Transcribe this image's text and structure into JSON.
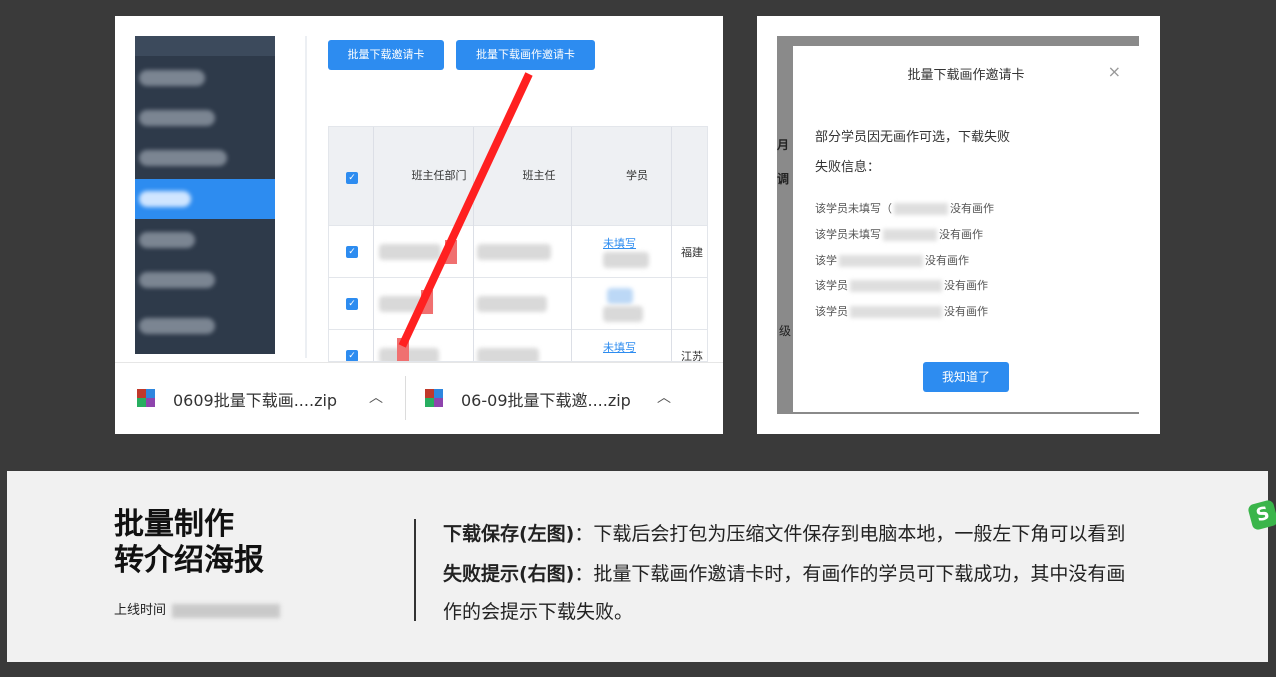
{
  "left_screenshot": {
    "buttons": {
      "batch_download_invitation": "批量下载邀请卡",
      "batch_download_artwork_invitation": "批量下载画作邀请卡"
    },
    "table": {
      "headers": [
        "班主任部门",
        "班主任",
        "学员"
      ],
      "rows": [
        {
          "checked": true,
          "student_link": "未填写",
          "tail": "福建"
        },
        {
          "checked": true,
          "student_link": "",
          "tail": ""
        },
        {
          "checked": true,
          "student_link": "未填写",
          "tail": "江苏"
        }
      ]
    },
    "downloads": [
      {
        "name": "0609批量下载画....zip"
      },
      {
        "name": "06-09批量下载邀....zip"
      }
    ],
    "colors": {
      "accent": "#2d8cf0",
      "arrow": "#ff2020"
    }
  },
  "right_screenshot": {
    "modal": {
      "title": "批量下载画作邀请卡",
      "message": "部分学员因无画作可选，下载失败",
      "info_label": "失败信息：",
      "lines": [
        {
          "prefix": "该学员未填写（",
          "suffix": "没有画作"
        },
        {
          "prefix": "该学员未填写",
          "suffix": "没有画作"
        },
        {
          "prefix": "该学",
          "suffix": "没有画作"
        },
        {
          "prefix": "该学员",
          "suffix": "没有画作"
        },
        {
          "prefix": "该学员",
          "suffix": "没有画作"
        }
      ],
      "ok_button": "我知道了"
    },
    "background_text": [
      "月",
      "调",
      "级"
    ]
  },
  "panel": {
    "title_line1": "批量制作",
    "title_line2": "转介绍海报",
    "time_label": "上线时间",
    "desc1_bold": "下载保存(左图)",
    "desc1_text": "：下载后会打包为压缩文件保存到电脑本地，一般左下角可以看到",
    "desc2_bold": "失败提示(右图)",
    "desc2_text": "：批量下载画作邀请卡时，有画作的学员可下载成功，其中没有画",
    "desc3_text": "作的会提示下载失败。"
  }
}
